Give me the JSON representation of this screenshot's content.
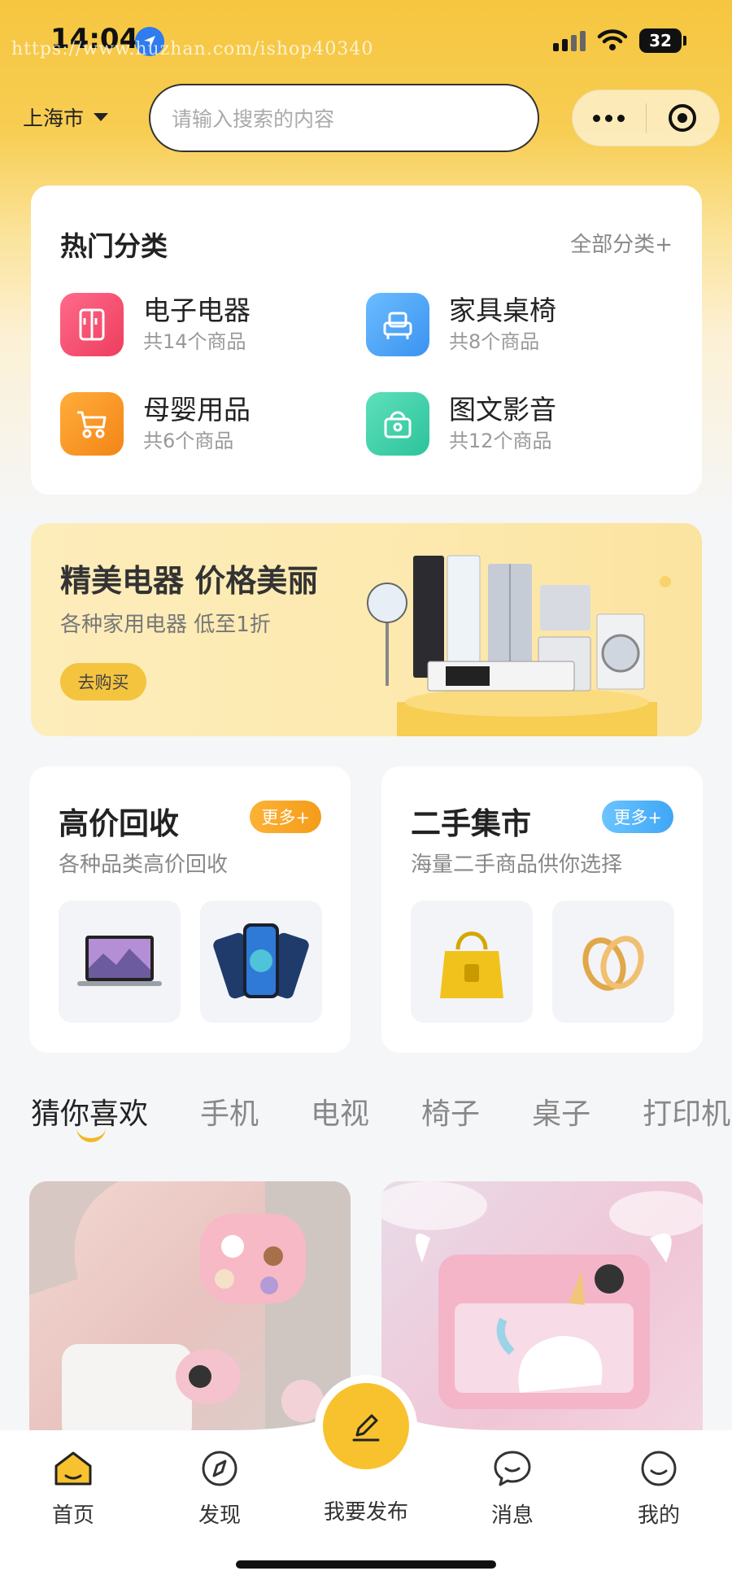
{
  "status_bar": {
    "time": "14:04",
    "battery": "32"
  },
  "watermark": "https://www.huzhan.com/ishop40340",
  "header": {
    "city": "上海市",
    "search_placeholder": "请输入搜索的内容"
  },
  "hot_categories": {
    "title": "热门分类",
    "all_link": "全部分类+",
    "items": [
      {
        "name": "电子电器",
        "count": "共14个商品",
        "icon": "fridge-icon",
        "color": "#f24d6e"
      },
      {
        "name": "家具桌椅",
        "count": "共8个商品",
        "icon": "armchair-icon",
        "color": "#3d9cf5"
      },
      {
        "name": "母婴用品",
        "count": "共6个商品",
        "icon": "stroller-icon",
        "color": "#f6921e"
      },
      {
        "name": "图文影音",
        "count": "共12个商品",
        "icon": "camera-bag-icon",
        "color": "#34cfa6"
      }
    ]
  },
  "banner": {
    "title": "精美电器 价格美丽",
    "subtitle": "各种家用电器 低至1折",
    "button": "去购买"
  },
  "recycle": {
    "title": "高价回收",
    "more": "更多+",
    "subtitle": "各种品类高价回收",
    "more_color": "#f6a623"
  },
  "market": {
    "title": "二手集市",
    "more": "更多+",
    "subtitle": "海量二手商品供你选择",
    "more_color": "#48aef7"
  },
  "tabs": [
    "猜你喜欢",
    "手机",
    "电视",
    "椅子",
    "桌子",
    "打印机"
  ],
  "bottom_nav": {
    "home": "首页",
    "discover": "发现",
    "publish": "我要发布",
    "messages": "消息",
    "mine": "我的"
  }
}
